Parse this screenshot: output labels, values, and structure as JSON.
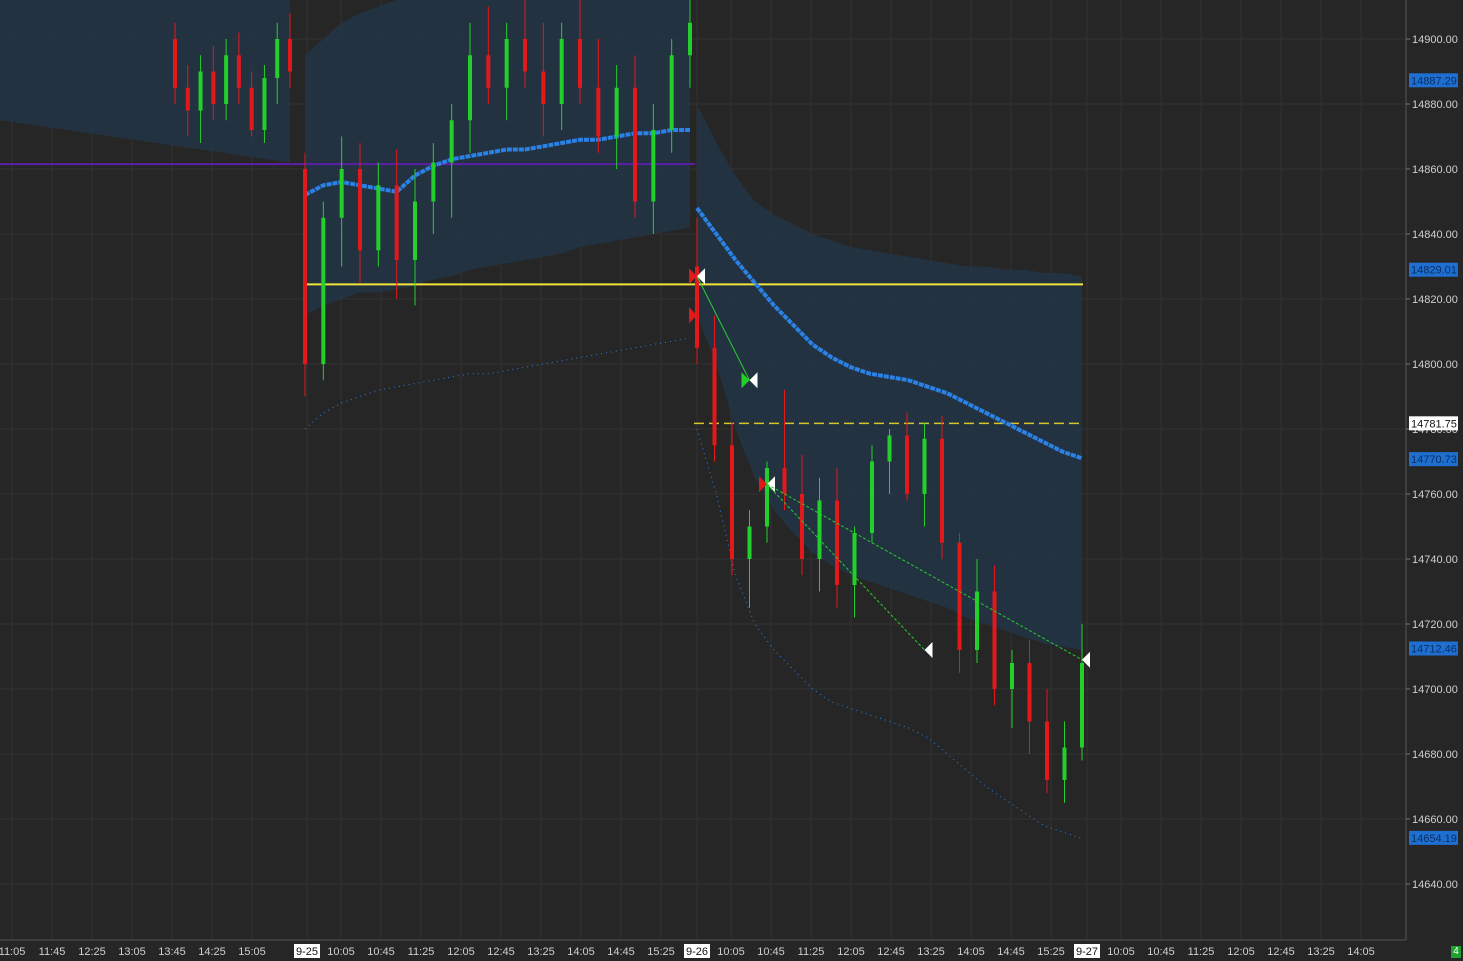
{
  "chart_data": {
    "type": "candlestick",
    "y_axis": {
      "ylim": [
        14628,
        14912
      ],
      "ticks": [
        14900,
        14880,
        14860,
        14840,
        14820,
        14800,
        14780,
        14760,
        14740,
        14720,
        14700,
        14680,
        14660,
        14640
      ],
      "tick_labels": [
        "14900.00",
        "14880.00",
        "14860.00",
        "14840.00",
        "14820.00",
        "14800.00",
        "14780.00",
        "14760.00",
        "14740.00",
        "14720.00",
        "14700.00",
        "14680.00",
        "14660.00",
        "14640.00"
      ]
    },
    "x_axis": {
      "labels": [
        "11:05",
        "11:45",
        "12:25",
        "13:05",
        "13:45",
        "14:25",
        "15:05",
        "9-25",
        "10:05",
        "10:45",
        "11:25",
        "12:05",
        "12:45",
        "13:25",
        "14:05",
        "14:45",
        "15:25",
        "9-26",
        "10:05",
        "10:45",
        "11:25",
        "12:05",
        "12:45",
        "13:25",
        "14:05",
        "14:45",
        "15:25",
        "9-27",
        "10:05",
        "10:45",
        "11:25",
        "12:05",
        "12:45",
        "13:25",
        "14:05"
      ],
      "session_markers": [
        "9-25",
        "9-26",
        "9-27"
      ]
    },
    "price_badges": [
      {
        "label": "14887.29",
        "value": 14887.29,
        "style": "blue"
      },
      {
        "label": "14829.01",
        "value": 14829.01,
        "style": "blue"
      },
      {
        "label": "14781.75",
        "value": 14781.75,
        "style": "white"
      },
      {
        "label": "14770.73",
        "value": 14770.73,
        "style": "blue"
      },
      {
        "label": "14712.46",
        "value": 14712.46,
        "style": "blue"
      },
      {
        "label": "14654.19",
        "value": 14654.19,
        "style": "blue"
      }
    ],
    "levels": [
      {
        "value": 14824.5,
        "color": "#f2e53a",
        "style": "solid",
        "range": "9-25 to 9-27"
      },
      {
        "value": 14781.75,
        "color": "#d6c52a",
        "style": "dashed",
        "range": "9-26 to 9-27"
      },
      {
        "value": 14861.5,
        "color": "#5c1fa8",
        "style": "solid",
        "range": "prior to 9-25"
      }
    ],
    "sessions": [
      {
        "name": "prev",
        "vwap": null,
        "bands": {
          "upper": [
            14905,
            14907,
            14905
          ],
          "lower": [
            14860,
            14864,
            14858
          ],
          "outer_upper": [
            14912,
            14912,
            14912
          ],
          "outer_lower": [
            14858,
            14862,
            14856
          ]
        },
        "ohlc": [
          [
            14900,
            14905,
            14880,
            14885
          ],
          [
            14885,
            14892,
            14870,
            14878
          ],
          [
            14878,
            14895,
            14868,
            14890
          ],
          [
            14890,
            14898,
            14875,
            14880
          ],
          [
            14880,
            14900,
            14875,
            14895
          ],
          [
            14895,
            14902,
            14880,
            14885
          ],
          [
            14885,
            14890,
            14870,
            14872
          ],
          [
            14872,
            14892,
            14868,
            14888
          ],
          [
            14888,
            14905,
            14880,
            14900
          ],
          [
            14900,
            14908,
            14885,
            14890
          ]
        ]
      },
      {
        "name": "9-25",
        "vwap": [
          14852,
          14855,
          14856,
          14855,
          14854,
          14853,
          14858,
          14861,
          14863,
          14864,
          14865,
          14866,
          14866,
          14867,
          14868,
          14869,
          14869,
          14870,
          14871,
          14871,
          14872,
          14872
        ],
        "band_upper": [
          14895,
          14900,
          14905,
          14908,
          14910,
          14912,
          14912,
          14912,
          14912,
          14912,
          14912,
          14912,
          14912,
          14912,
          14912,
          14912,
          14912,
          14912,
          14912,
          14912,
          14912,
          14912
        ],
        "band_lower": [
          14815,
          14818,
          14820,
          14822,
          14822,
          14823,
          14824,
          14826,
          14827,
          14829,
          14830,
          14831,
          14832,
          14833,
          14834,
          14836,
          14837,
          14838,
          14839,
          14840,
          14841,
          14842
        ],
        "outer_lower": [
          14780,
          14785,
          14788,
          14790,
          14792,
          14793,
          14794,
          14795,
          14796,
          14797,
          14797,
          14798,
          14799,
          14800,
          14801,
          14802,
          14803,
          14804,
          14805,
          14806,
          14807,
          14808
        ],
        "ohlc": [
          [
            14860,
            14865,
            14790,
            14800
          ],
          [
            14800,
            14850,
            14795,
            14845
          ],
          [
            14845,
            14870,
            14830,
            14860
          ],
          [
            14860,
            14868,
            14825,
            14835
          ],
          [
            14835,
            14862,
            14830,
            14855
          ],
          [
            14855,
            14866,
            14820,
            14832
          ],
          [
            14832,
            14860,
            14818,
            14850
          ],
          [
            14850,
            14868,
            14840,
            14862
          ],
          [
            14862,
            14880,
            14845,
            14875
          ],
          [
            14875,
            14905,
            14865,
            14895
          ],
          [
            14895,
            14910,
            14880,
            14885
          ],
          [
            14885,
            14905,
            14875,
            14900
          ],
          [
            14900,
            14912,
            14885,
            14890
          ],
          [
            14890,
            14905,
            14870,
            14880
          ],
          [
            14880,
            14905,
            14872,
            14900
          ],
          [
            14900,
            14912,
            14880,
            14885
          ],
          [
            14885,
            14900,
            14865,
            14870
          ],
          [
            14870,
            14892,
            14860,
            14885
          ],
          [
            14885,
            14895,
            14845,
            14850
          ],
          [
            14850,
            14880,
            14840,
            14872
          ],
          [
            14872,
            14900,
            14865,
            14895
          ],
          [
            14895,
            14912,
            14885,
            14905
          ]
        ]
      },
      {
        "name": "9-26",
        "vwap": [
          14848,
          14840,
          14832,
          14825,
          14818,
          14812,
          14806,
          14802,
          14799,
          14797,
          14796,
          14795,
          14793,
          14791,
          14788,
          14785,
          14782,
          14779,
          14776,
          14773,
          14771
        ],
        "band_upper": [
          14880,
          14868,
          14858,
          14850,
          14846,
          14843,
          14840,
          14838,
          14836,
          14835,
          14834,
          14833,
          14832,
          14831,
          14830,
          14830,
          14829,
          14829,
          14828,
          14828,
          14827
        ],
        "band_lower": [
          14815,
          14800,
          14780,
          14765,
          14755,
          14748,
          14742,
          14738,
          14735,
          14733,
          14731,
          14729,
          14727,
          14725,
          14722,
          14720,
          14718,
          14716,
          14714,
          14713,
          14712
        ],
        "outer_lower": [
          14780,
          14760,
          14735,
          14720,
          14712,
          14706,
          14700,
          14696,
          14694,
          14692,
          14690,
          14688,
          14685,
          14680,
          14675,
          14670,
          14666,
          14662,
          14658,
          14656,
          14654
        ],
        "ohlc": [
          [
            14830,
            14845,
            14800,
            14805
          ],
          [
            14805,
            14815,
            14770,
            14775
          ],
          [
            14775,
            14782,
            14735,
            14740
          ],
          [
            14740,
            14755,
            14725,
            14750
          ],
          [
            14750,
            14770,
            14745,
            14768
          ],
          [
            14768,
            14792,
            14755,
            14760
          ],
          [
            14760,
            14772,
            14735,
            14740
          ],
          [
            14740,
            14765,
            14730,
            14758
          ],
          [
            14758,
            14768,
            14725,
            14732
          ],
          [
            14732,
            14750,
            14722,
            14748
          ],
          [
            14748,
            14775,
            14745,
            14770
          ],
          [
            14770,
            14780,
            14760,
            14778
          ],
          [
            14778,
            14785,
            14758,
            14760
          ],
          [
            14760,
            14782,
            14750,
            14777
          ],
          [
            14777,
            14784,
            14740,
            14745
          ],
          [
            14745,
            14748,
            14705,
            14712
          ],
          [
            14712,
            14740,
            14708,
            14730
          ],
          [
            14730,
            14738,
            14695,
            14700
          ],
          [
            14700,
            14712,
            14688,
            14708
          ],
          [
            14708,
            14715,
            14680,
            14690
          ],
          [
            14690,
            14700,
            14668,
            14672
          ],
          [
            14672,
            14690,
            14665,
            14682
          ],
          [
            14682,
            14720,
            14678,
            14708
          ]
        ]
      }
    ],
    "trade_markers": [
      {
        "session": "9-26",
        "index": 0,
        "price": 14827,
        "side": "entry-short"
      },
      {
        "session": "9-26",
        "index": 0,
        "price": 14815,
        "side": "entry-short-red"
      },
      {
        "session": "9-26",
        "index": 3,
        "price": 14795,
        "side": "exit-long"
      },
      {
        "session": "9-26",
        "index": 4,
        "price": 14763,
        "side": "entry"
      },
      {
        "session": "9-26",
        "index": 13,
        "price": 14712,
        "side": "exit"
      },
      {
        "session": "9-26",
        "index": 22,
        "price": 14709,
        "side": "exit"
      }
    ],
    "colors": {
      "background": "#262626",
      "grid": "#323232",
      "up": "#23d02b",
      "down": "#e3181b",
      "vwap": "#2a82e6",
      "band_fill": "#243445",
      "level_yellow": "#f2e53a"
    }
  },
  "status": {
    "connection_count": "4"
  }
}
